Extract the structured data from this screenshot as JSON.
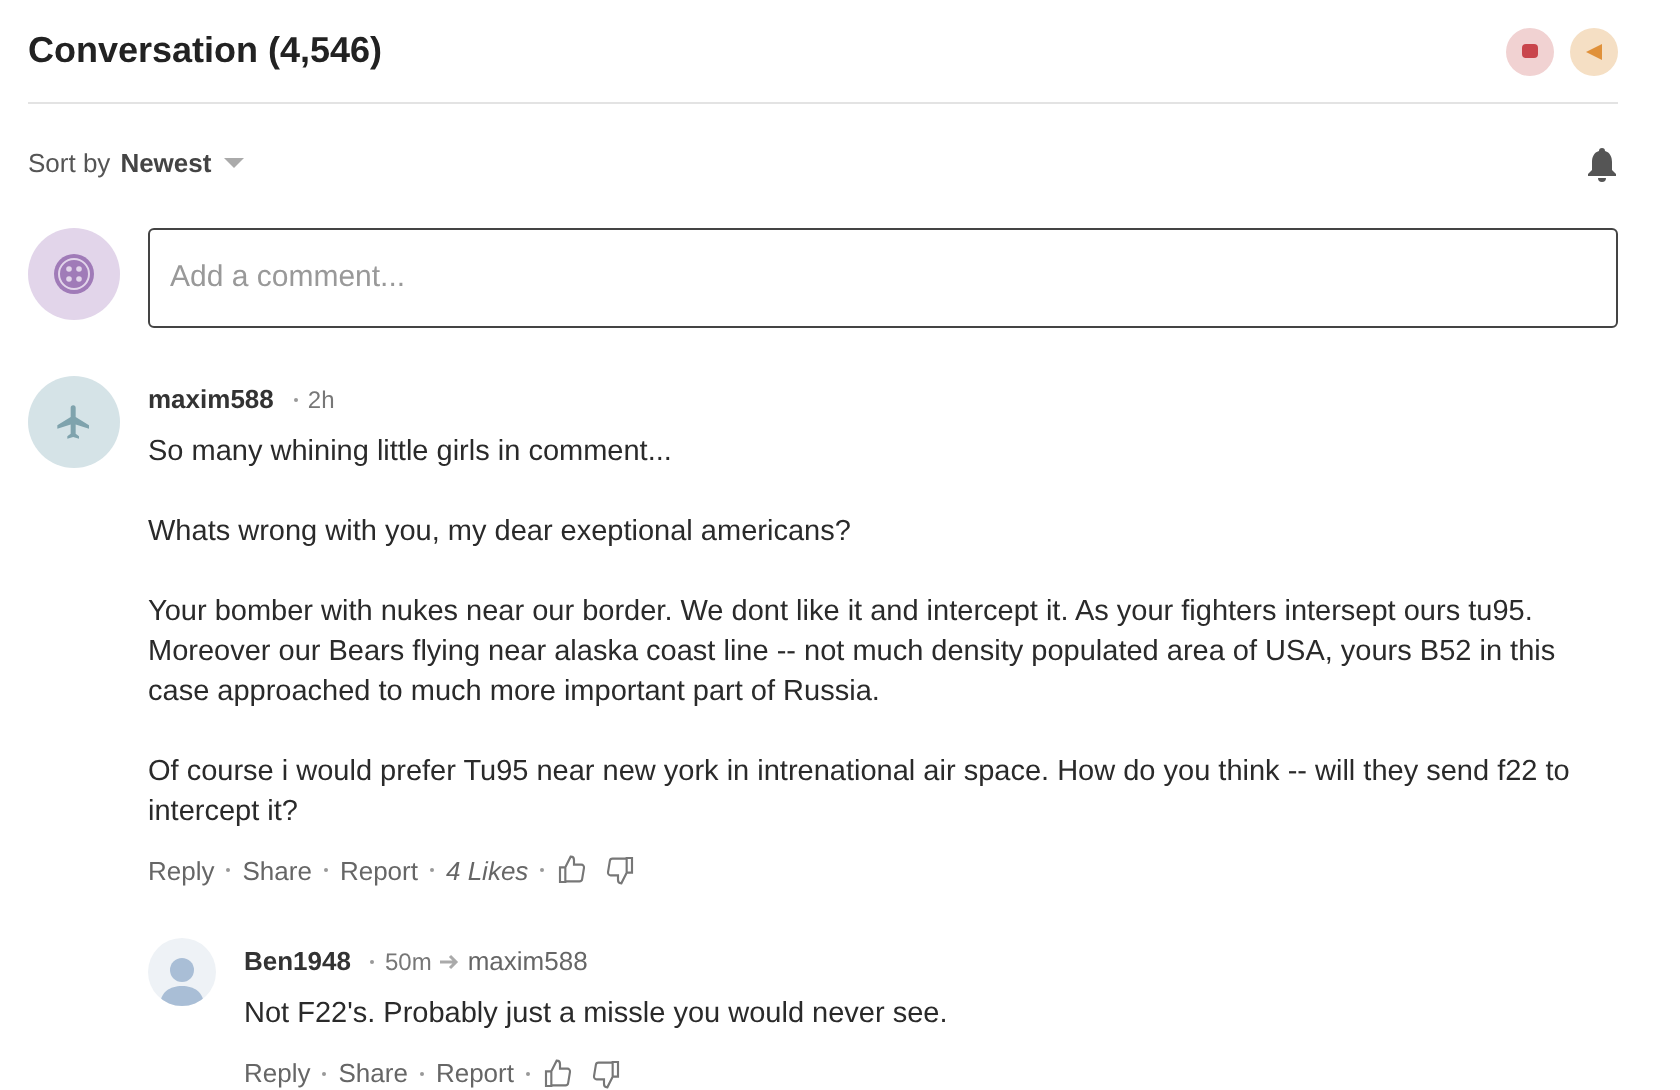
{
  "header": {
    "title": "Conversation (4,546)"
  },
  "sort": {
    "label": "Sort by",
    "value": "Newest"
  },
  "composer": {
    "placeholder": "Add a comment..."
  },
  "comments": [
    {
      "author": "maxim588",
      "time": "2h",
      "avatar": {
        "kind": "plane"
      },
      "paragraphs": [
        "So many whining little girls in comment...",
        "Whats wrong with you, my dear exeptional americans?",
        "Your bomber with nukes near our border. We dont like it and intercept it. As your fighters intersept ours tu95. Moreover our Bears flying near alaska coast line -- not much density populated area of USA, yours B52 in this case approached to much more important part of Russia.",
        "Of course i would prefer Tu95 near new york in intrenational air space. How do you think -- will they send f22 to intercept it?"
      ],
      "actions": [
        "Reply",
        "Share",
        "Report"
      ],
      "likes": "4 Likes",
      "children": [
        {
          "author": "Ben1948",
          "time": "50m",
          "reply_to": "maxim588",
          "avatar": {
            "kind": "person"
          },
          "paragraphs": [
            "Not F22's. Probably just a missle you would never see."
          ],
          "actions": [
            "Reply",
            "Share",
            "Report"
          ]
        }
      ]
    }
  ]
}
